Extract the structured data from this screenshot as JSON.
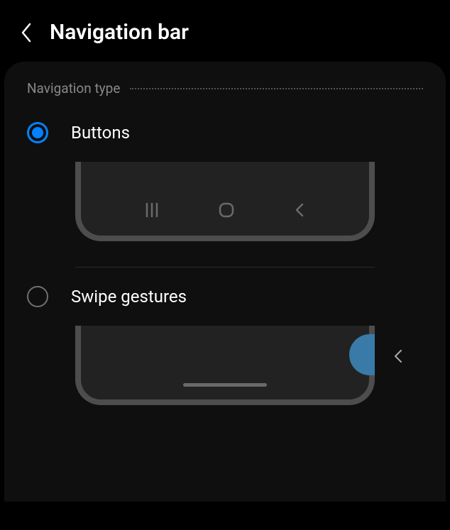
{
  "header": {
    "title": "Navigation bar"
  },
  "section": {
    "label": "Navigation type"
  },
  "options": {
    "buttons": {
      "label": "Buttons",
      "selected": true
    },
    "swipe": {
      "label": "Swipe gestures",
      "selected": false
    }
  },
  "colors": {
    "accent": "#0381fe",
    "swipeBlob": "#3a7aa8"
  }
}
